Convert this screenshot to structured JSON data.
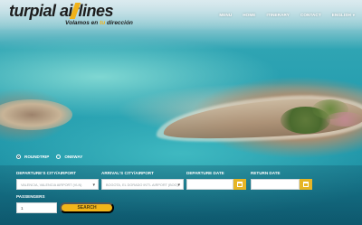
{
  "brand": {
    "name_part1": "turpial",
    "name_part2": "airlines",
    "tagline_part1": "Volamos en ",
    "tagline_accent": "tu",
    "tagline_part2": " dirección"
  },
  "nav": {
    "items": [
      {
        "label": "MENU"
      },
      {
        "label": "HOME"
      },
      {
        "label": "ITINERARY"
      },
      {
        "label": "CONTACT"
      },
      {
        "label": "ENGLISH"
      }
    ]
  },
  "trip_type": {
    "roundtrip_label": "ROUNDTRIP",
    "oneway_label": "ONEWAY",
    "selected": "roundtrip"
  },
  "form": {
    "departure_label": "DEPARTURE'S CITY/AIRPORT",
    "departure_value": "VALENCIA, VALENCIA AIRPORT (VLN)",
    "arrival_label": "ARRIVAL'S CITY/AIRPORT",
    "arrival_value": "BOGOTA, EL DORADO INT'L AIRPORT (BOG)",
    "departure_date_label": "DEPARTURE DATE",
    "departure_date_value": "",
    "return_date_label": "RETURN DATE",
    "return_date_value": "",
    "passengers_label": "PASSENGERS",
    "passengers_value": "1",
    "search_label": "SEARCH"
  },
  "colors": {
    "accent": "#f2b51a",
    "nav_text": "#ffffff"
  }
}
